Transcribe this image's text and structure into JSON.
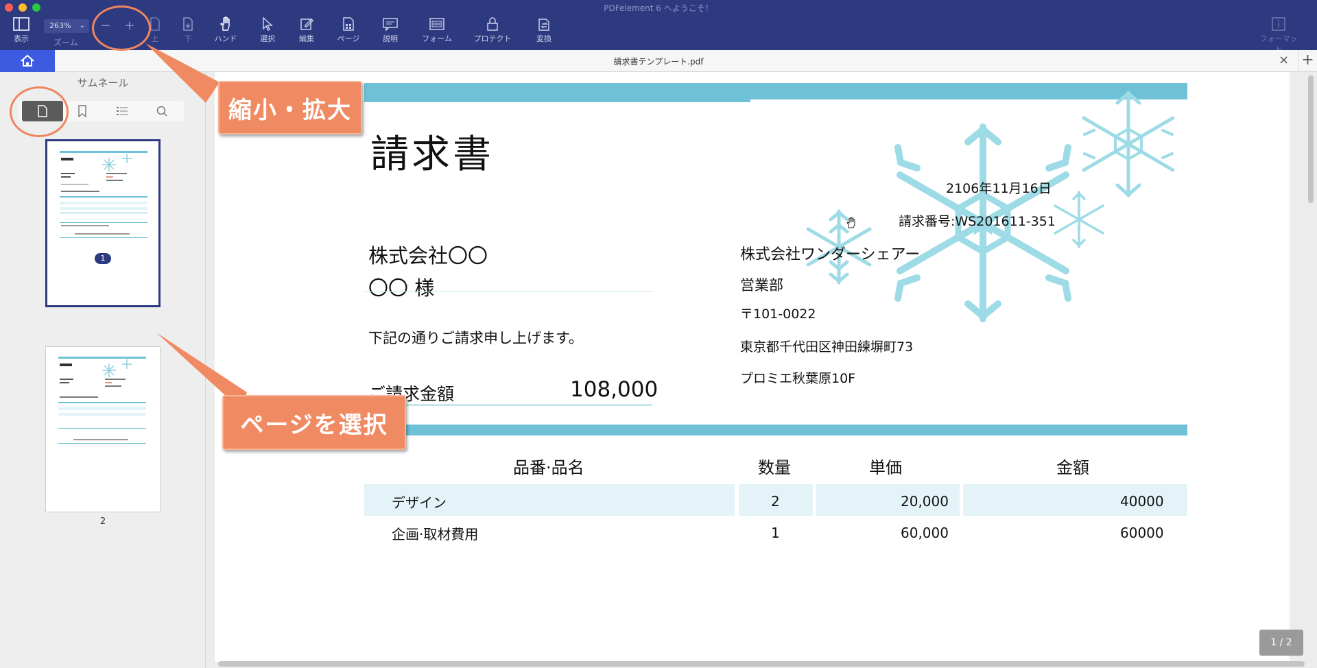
{
  "window": {
    "title": "PDFelement 6 へようこそ！"
  },
  "toolbar": {
    "view_label": "表示",
    "zoom_value": "263%",
    "zoom_label": "ズーム",
    "zoom_out": "−",
    "zoom_in": "+",
    "up_label": "上",
    "down_label": "下",
    "hand_label": "ハンド",
    "select_label": "選択",
    "edit_label": "編集",
    "page_label": "ページ",
    "comment_label": "説明",
    "form_label": "フォーム",
    "protect_label": "プロテクト",
    "convert_label": "変換",
    "format_label": "フォーマット"
  },
  "tabbar": {
    "doc_title": "請求書テンプレート.pdf",
    "close": "×",
    "add": "+"
  },
  "sidebar": {
    "title": "サムネール",
    "pages": [
      {
        "label": "1"
      },
      {
        "label": "2"
      }
    ]
  },
  "callouts": {
    "zoom": "縮小・拡大",
    "select_page": "ページを選択"
  },
  "invoice": {
    "title": "請求書",
    "date": "2106年11月16日",
    "number": "請求番号:WS201611-351",
    "client_company": "株式会社〇〇",
    "client_name": "〇〇 様",
    "note": "下記の通りご請求申し上げます。",
    "amount_label": "ご請求金額",
    "amount_value": "108,000",
    "issuer_company": "株式会社ワンダーシェアー",
    "issuer_dept": "営業部",
    "issuer_zip": "〒101-0022",
    "issuer_addr": "東京都千代田区神田練塀町73",
    "issuer_bldg": "プロミエ秋葉原10F",
    "table": {
      "headers": [
        "品番·品名",
        "数量",
        "単価",
        "金額"
      ],
      "rows": [
        [
          "デザイン",
          "2",
          "20,000",
          "40000"
        ],
        [
          "企画·取材費用",
          "1",
          "60,000",
          "60000"
        ]
      ]
    }
  },
  "viewer": {
    "page_counter": "1 / 2"
  },
  "colors": {
    "toolbar": "#2e3a80",
    "accent": "#6ec1d6",
    "callout": "#f08a63"
  }
}
